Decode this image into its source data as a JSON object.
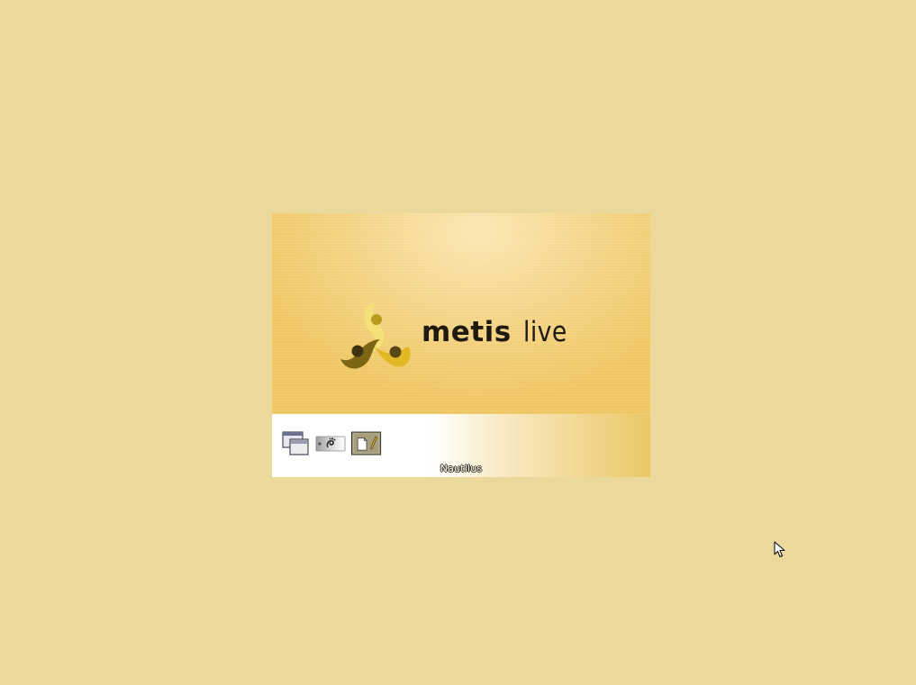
{
  "desktop": {
    "background_color": "#ebd99c"
  },
  "splash": {
    "brand_bold": "metis",
    "brand_light": "live",
    "current_step_label": "Nautilus",
    "steps": [
      {
        "icon": "window-manager-icon"
      },
      {
        "icon": "gnome-settings-icon"
      },
      {
        "icon": "nautilus-file-manager-icon"
      }
    ],
    "colors": {
      "logo_dark": "#7d6613",
      "logo_gold": "#e2b824",
      "logo_pale": "#f6e07a",
      "banner_light": "#fbe7b3",
      "banner_dark": "#efc762"
    }
  },
  "cursor": {
    "icon": "mouse-pointer-icon"
  }
}
